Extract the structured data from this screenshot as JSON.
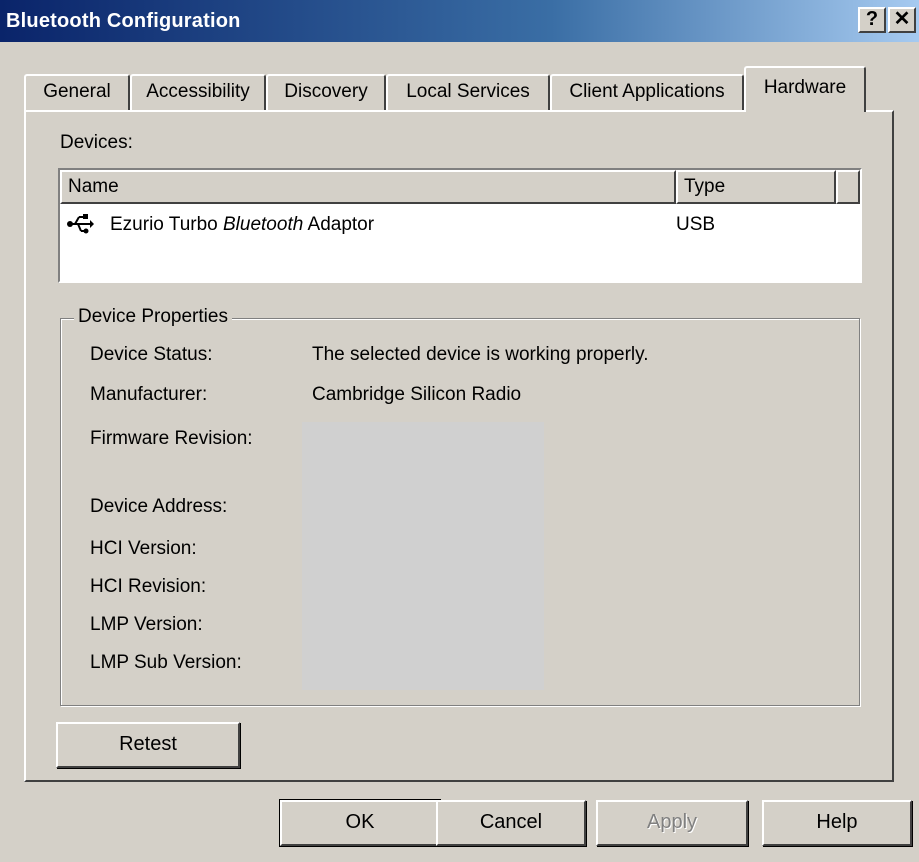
{
  "window": {
    "title": "Bluetooth Configuration",
    "help_button": "?",
    "close_button": "✕"
  },
  "tabs": [
    {
      "label": "General"
    },
    {
      "label": "Accessibility"
    },
    {
      "label": "Discovery"
    },
    {
      "label": "Local Services"
    },
    {
      "label": "Client Applications"
    },
    {
      "label": "Hardware",
      "active": true
    }
  ],
  "devices": {
    "label": "Devices:",
    "columns": {
      "name": "Name",
      "type": "Type"
    },
    "rows": [
      {
        "icon": "usb-icon",
        "name_prefix": "Ezurio Turbo ",
        "name_italic": "Bluetooth",
        "name_suffix": " Adaptor",
        "type": "USB"
      }
    ]
  },
  "properties": {
    "legend": "Device Properties",
    "items": [
      {
        "label": "Device Status:",
        "value": "The selected device is working properly."
      },
      {
        "label": "Manufacturer:",
        "value": "Cambridge Silicon Radio"
      },
      {
        "label": "Firmware Revision:",
        "value": ""
      },
      {
        "label": "Device Address:",
        "value": ""
      },
      {
        "label": "HCI Version:",
        "value": ""
      },
      {
        "label": "HCI Revision:",
        "value": ""
      },
      {
        "label": "LMP Version:",
        "value": ""
      },
      {
        "label": "LMP Sub Version:",
        "value": ""
      }
    ]
  },
  "buttons": {
    "retest": "Retest",
    "ok": "OK",
    "cancel": "Cancel",
    "apply": "Apply",
    "help": "Help"
  }
}
